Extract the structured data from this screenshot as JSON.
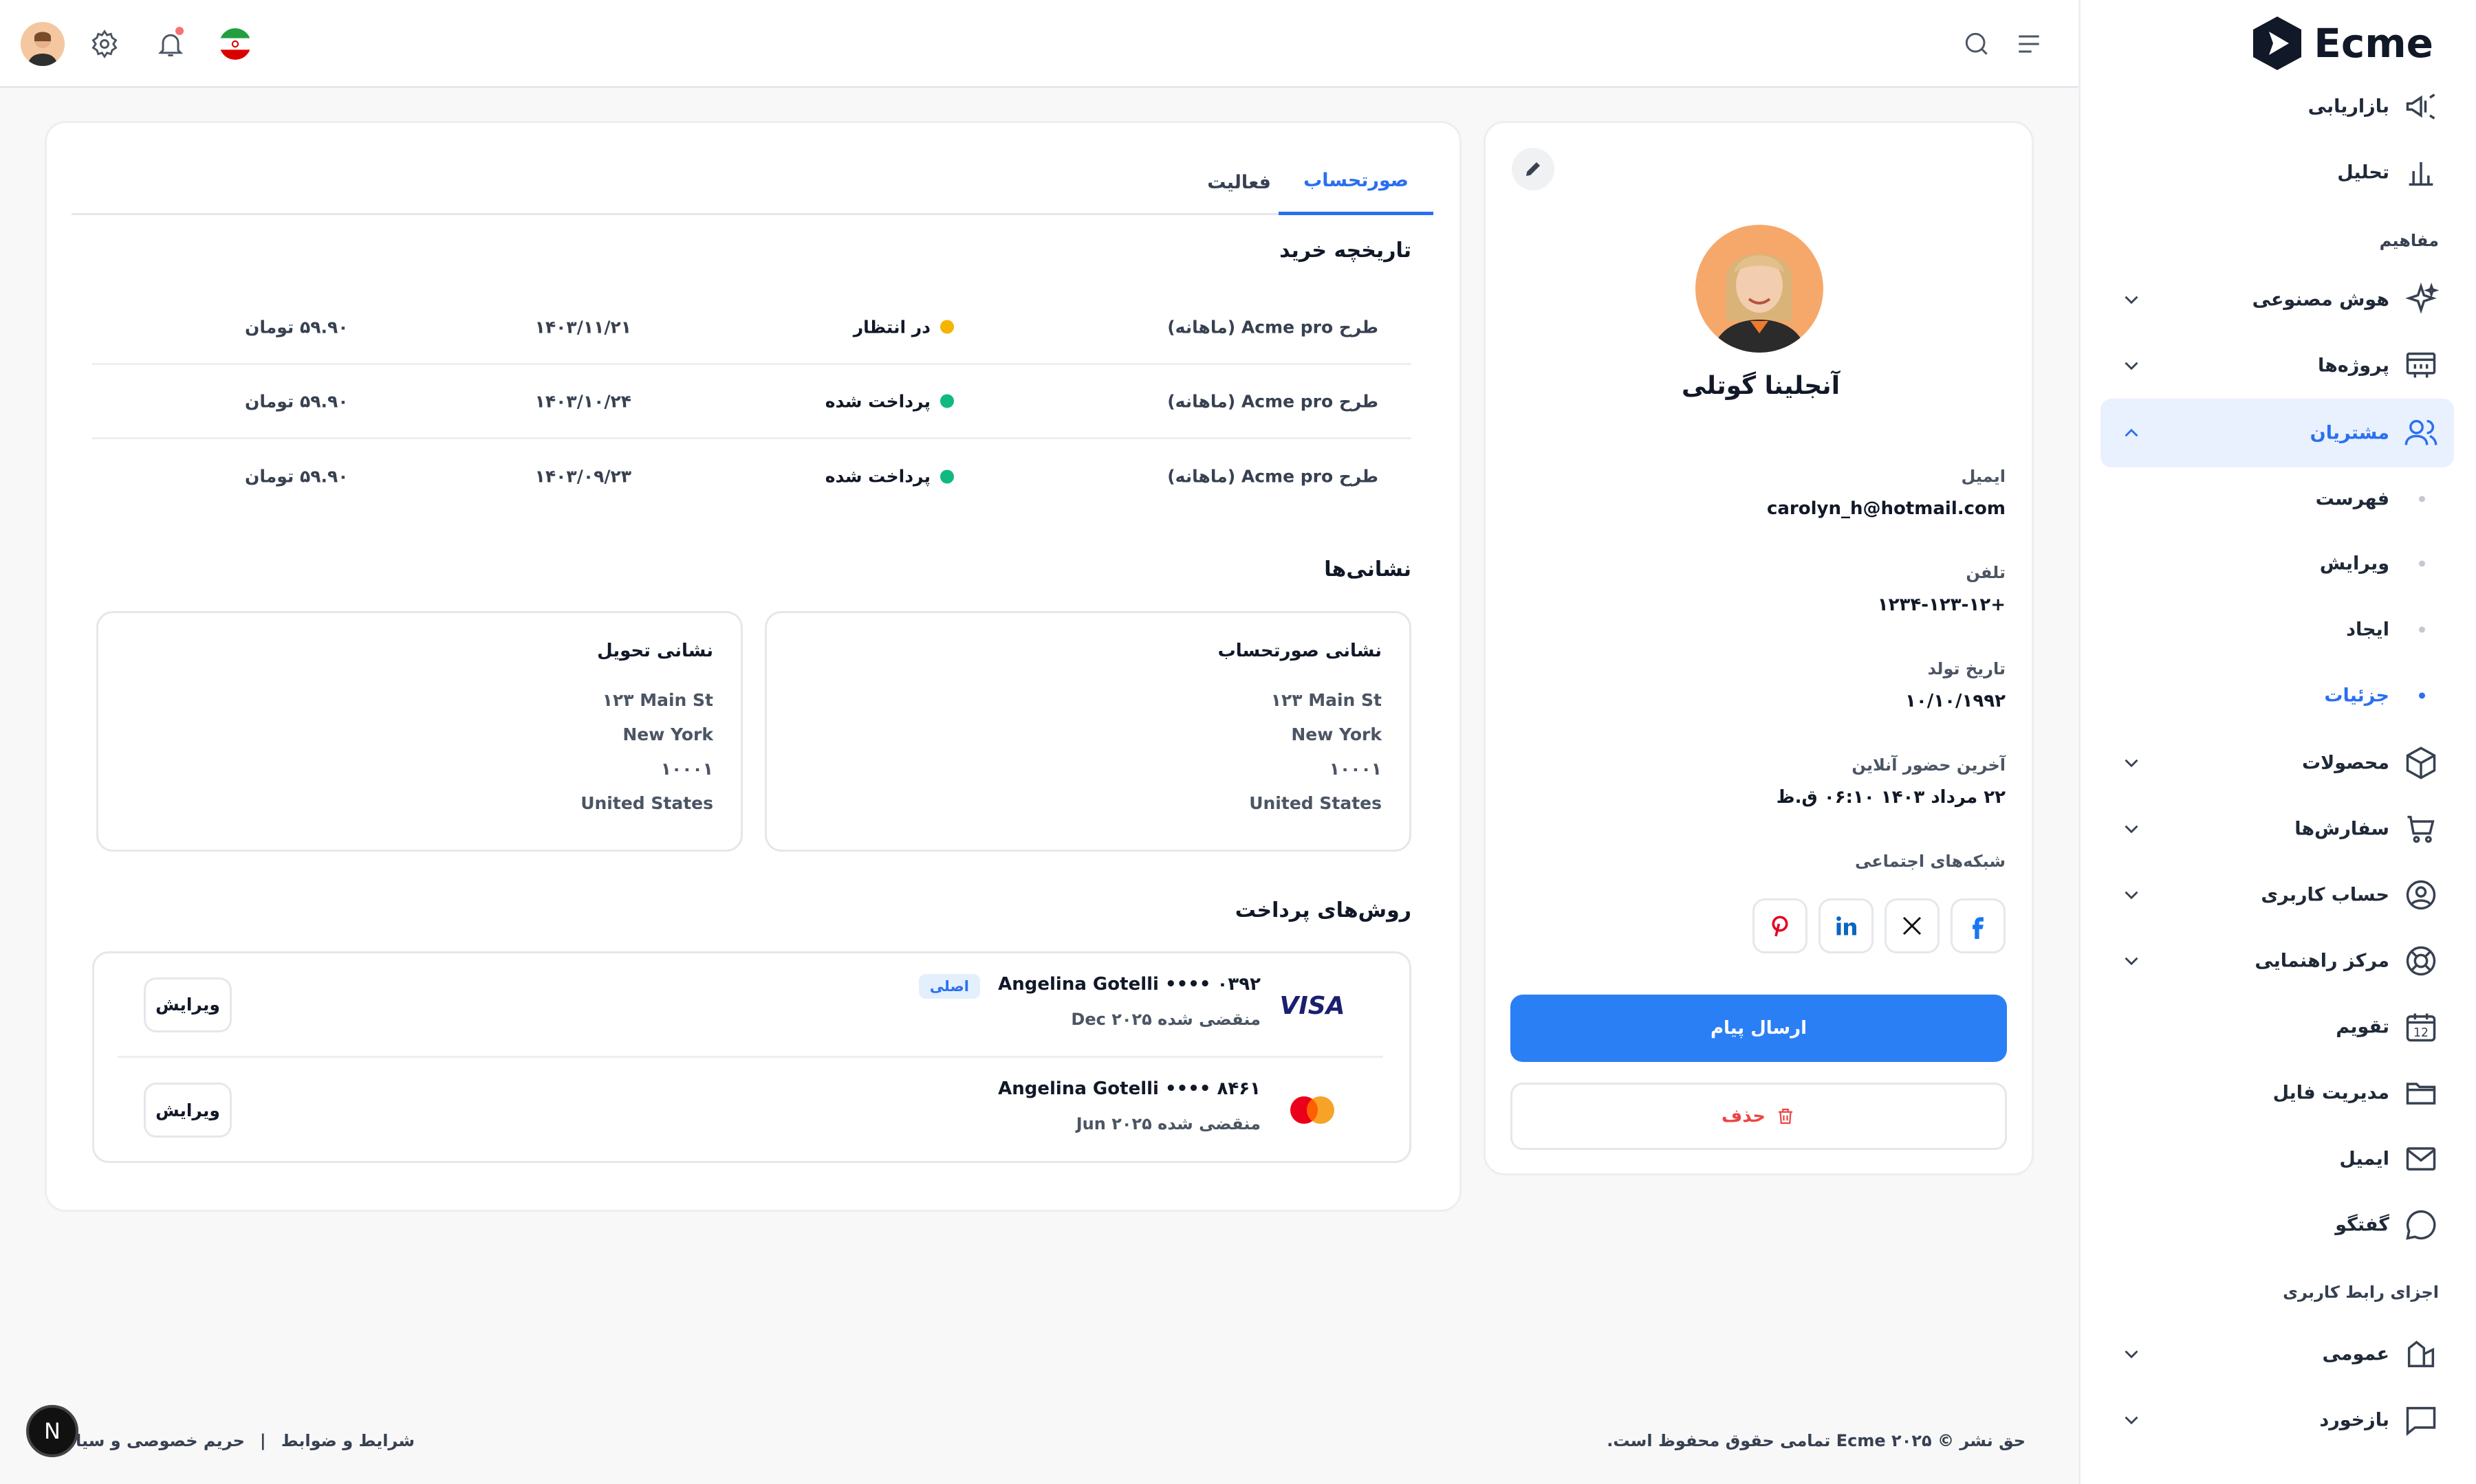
{
  "app": {
    "logo_text": "Ecme"
  },
  "sidebar": {
    "items_top": [
      {
        "label": "بازاریابی",
        "icon": "megaphone-icon"
      },
      {
        "label": "تحلیل",
        "icon": "bar-chart-icon"
      }
    ],
    "section_concepts": "مفاهیم",
    "concepts": [
      {
        "label": "هوش مصنوعی",
        "icon": "sparkles-icon"
      },
      {
        "label": "پروژه‌ها",
        "icon": "projects-icon"
      },
      {
        "label": "مشتریان",
        "icon": "users-icon",
        "active": true
      }
    ],
    "customer_sub": [
      {
        "label": "فهرست"
      },
      {
        "label": "ویرایش"
      },
      {
        "label": "ایجاد"
      },
      {
        "label": "جزئیات",
        "active": true
      }
    ],
    "items_after": [
      {
        "label": "محصولات",
        "icon": "box-icon"
      },
      {
        "label": "سفارش‌ها",
        "icon": "cart-icon"
      },
      {
        "label": "حساب کاربری",
        "icon": "user-circle-icon"
      },
      {
        "label": "مرکز راهنمایی",
        "icon": "help-icon"
      },
      {
        "label": "تقویم",
        "icon": "calendar-icon"
      },
      {
        "label": "مدیریت فایل",
        "icon": "folder-icon"
      },
      {
        "label": "ایمیل",
        "icon": "mail-icon"
      },
      {
        "label": "گفتگو",
        "icon": "chat-icon"
      }
    ],
    "section_ui": "اجزای رابط کاربری",
    "ui_items": [
      {
        "label": "عمومی",
        "icon": "shapes-icon"
      },
      {
        "label": "بازخورد",
        "icon": "feedback-icon"
      }
    ]
  },
  "header": {
    "calendar_day": "12"
  },
  "profile": {
    "name": "آنجلینا گوتلی",
    "email_label": "ایمیل",
    "email": "carolyn_h@hotmail.com",
    "phone_label": "تلفن",
    "phone": "+۱۲۳۴-۱۲۳-۱۲",
    "birth_label": "تاریخ تولد",
    "birth": "۱۰/۱۰/۱۹۹۲",
    "last_online_label": "آخرین حضور آنلاین",
    "last_online": "۲۲ مرداد ۱۴۰۳ ۰۶:۱۰ ق.ظ",
    "social_label": "شبکه‌های اجتماعی",
    "send_message": "ارسال پیام",
    "delete": "حذف"
  },
  "tabs": [
    {
      "label": "صورتحساب",
      "active": true
    },
    {
      "label": "فعالیت",
      "active": false
    }
  ],
  "history": {
    "title": "تاریخچه خرید",
    "rows": [
      {
        "plan": "طرح Acme pro (ماهانه)",
        "status": "در انتظار",
        "status_color": "#f5b400",
        "date": "۱۴۰۳/۱۱/۲۱",
        "amount": "۵۹.۹۰ تومان"
      },
      {
        "plan": "طرح Acme pro (ماهانه)",
        "status": "پرداخت شده",
        "status_color": "#10b981",
        "date": "۱۴۰۳/۱۰/۲۴",
        "amount": "۵۹.۹۰ تومان"
      },
      {
        "plan": "طرح Acme pro (ماهانه)",
        "status": "پرداخت شده",
        "status_color": "#10b981",
        "date": "۱۴۰۳/۰۹/۲۳",
        "amount": "۵۹.۹۰ تومان"
      }
    ]
  },
  "addresses": {
    "title": "نشانی‌ها",
    "billing": {
      "title": "نشانی صورتحساب",
      "line1": "۱۲۳ Main St",
      "city": "New York",
      "zip": "۱۰۰۰۱",
      "country": "United States"
    },
    "shipping": {
      "title": "نشانی تحویل",
      "line1": "۱۲۳ Main St",
      "city": "New York",
      "zip": "۱۰۰۰۱",
      "country": "United States"
    }
  },
  "payment": {
    "title": "روش‌های پرداخت",
    "cards": [
      {
        "brand": "VISA",
        "name": "Angelina Gotelli •••• ۰۳۹۲",
        "expiry": "منقضی شده Dec ۲۰۲۵",
        "badge": "اصلی",
        "edit": "ویرایش"
      },
      {
        "brand": "mastercard",
        "name": "Angelina Gotelli •••• ۸۴۶۱",
        "expiry": "منقضی شده Jun ۲۰۲۵",
        "edit": "ویرایش"
      }
    ]
  },
  "footer": {
    "copyright": "حق نشر © ۲۰۲۵ Ecme تمامی حقوق محفوظ است.",
    "terms": "شرایط و ضوابط",
    "separator": "|",
    "privacy": "حریم خصوصی و سیا",
    "badge": "N"
  },
  "colors": {
    "accent": "#2a7ff5",
    "pending": "#f5b400",
    "paid": "#10b981",
    "danger": "#ef4444"
  }
}
